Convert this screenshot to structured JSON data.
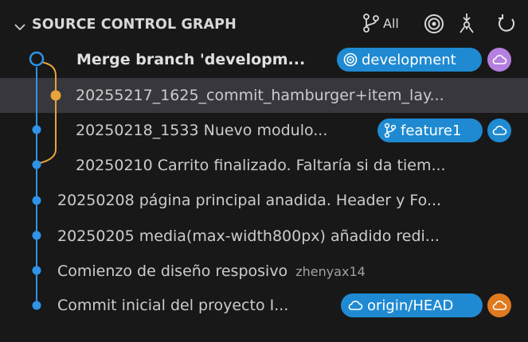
{
  "header": {
    "title": "SOURCE CONTROL GRAPH",
    "all_label": "All"
  },
  "colors": {
    "main_lane": "#2f93e8",
    "merge_lane": "#e8a33a",
    "pill_blue": "#1f8ad2",
    "purple_badge": "#b57fe0",
    "orange_badge": "#e07a1f",
    "selected_row": "#37373d"
  },
  "commits": [
    {
      "message": "Merge branch 'developm...",
      "ref": "development",
      "ref_icon": "target-icon",
      "badge": "cloud-icon",
      "badge_color": "purple"
    },
    {
      "message": "20255217_1625_commit_hamburger+item_lay...",
      "selected": true
    },
    {
      "message": "20250218_1533 Nuevo modulo...",
      "ref": "feature1",
      "ref_icon": "branch-icon",
      "badge": "cloud-icon",
      "badge_color": "blue"
    },
    {
      "message": "20250210 Carrito finalizado. Faltaría si da tiem..."
    },
    {
      "message": "20250208 página principal anadida. Header y Fo..."
    },
    {
      "message": "20250205 media(max-width800px) añadido redi..."
    },
    {
      "message": "Comienzo de diseño resposivo",
      "author": "zhenyax14"
    },
    {
      "message": "Commit inicial del proyecto I...",
      "ref": "origin/HEAD",
      "ref_icon": "cloud-icon",
      "badge": "cloud-icon",
      "badge_color": "orange"
    }
  ]
}
